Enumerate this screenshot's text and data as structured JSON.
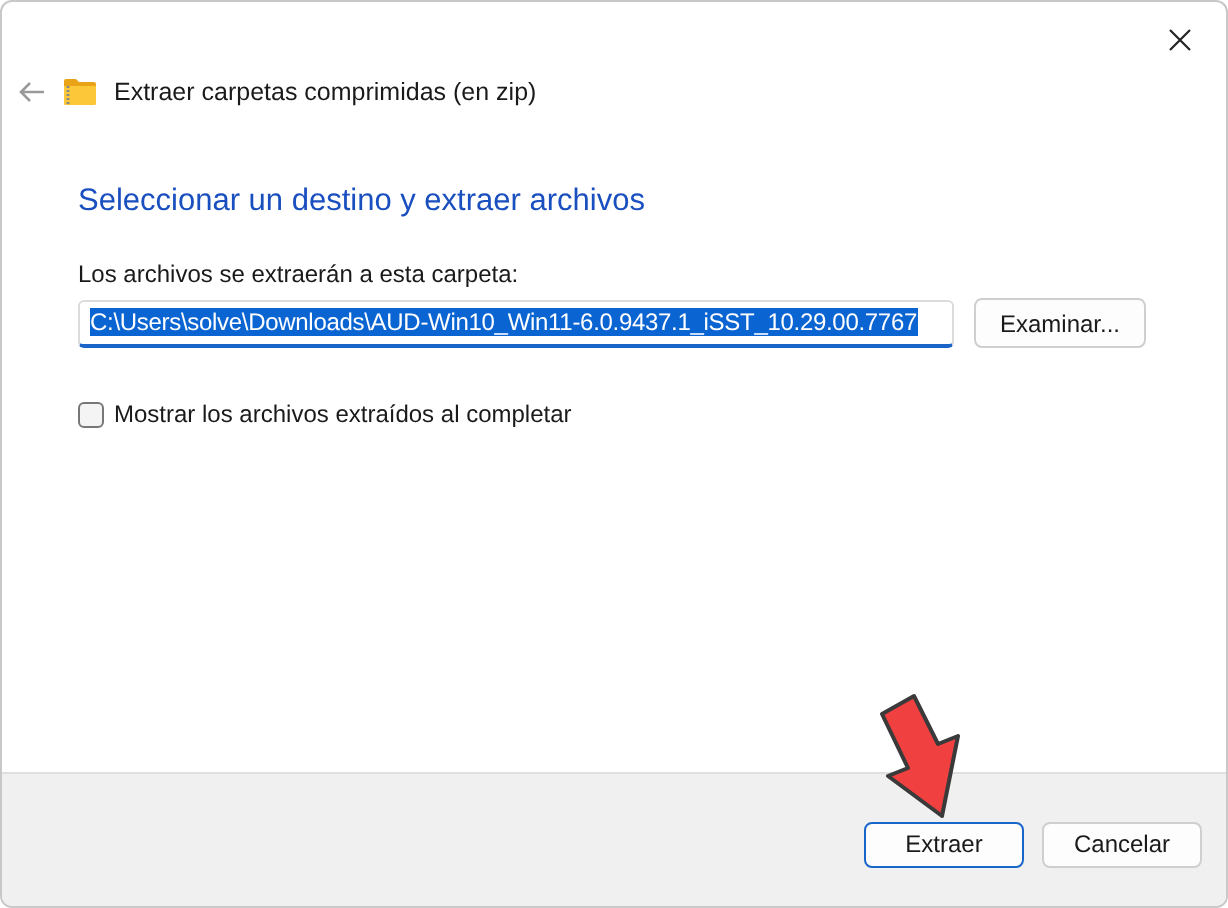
{
  "window": {
    "title": "Extraer carpetas comprimidas (en zip)"
  },
  "heading": "Seleccionar un destino y extraer archivos",
  "destination": {
    "label": "Los archivos se extraerán a esta carpeta:",
    "value": "C:\\Users\\solve\\Downloads\\AUD-Win10_Win11-6.0.9437.1_iSST_10.29.00.7767",
    "text_selected": true,
    "browse_button": "Examinar..."
  },
  "show_files": {
    "label": "Mostrar los archivos extraídos al completar",
    "checked": false
  },
  "buttons": [
    {
      "label": "Extraer",
      "default": true
    },
    {
      "label": "Cancelar",
      "default": false
    }
  ]
}
